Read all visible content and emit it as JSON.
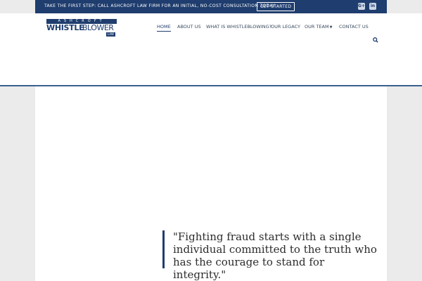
{
  "topbar": {
    "message": "TAKE THE FIRST STEP: CALL ASHCROFT LAW FIRM FOR AN INITIAL, NO-COST CONSULTATION TODAY",
    "cta_label": "GET STARTED",
    "social": [
      {
        "icon": "google-plus-icon",
        "glyph": "G+"
      },
      {
        "icon": "linkedin-icon",
        "glyph": "in"
      }
    ]
  },
  "logo": {
    "top": "ASHCROFT",
    "bold": "WHISTLE",
    "light": "BLOWER",
    "tag": "LAW"
  },
  "nav": [
    {
      "label": "HOME",
      "active": true
    },
    {
      "label": "ABOUT US"
    },
    {
      "label": "WHAT IS WHISTLEBLOWING?"
    },
    {
      "label": "OUR LEGACY"
    },
    {
      "label": "OUR TEAM",
      "has_dropdown": true
    },
    {
      "label": "CONTACT US"
    }
  ],
  "hero": {
    "quote": "\"Fighting fraud starts with a single individual committed to the truth who has the courage to stand for integrity.\""
  },
  "colors": {
    "brand": "#1f3d6e",
    "page_bg": "#ebebeb",
    "text": "#2c2c2c"
  }
}
